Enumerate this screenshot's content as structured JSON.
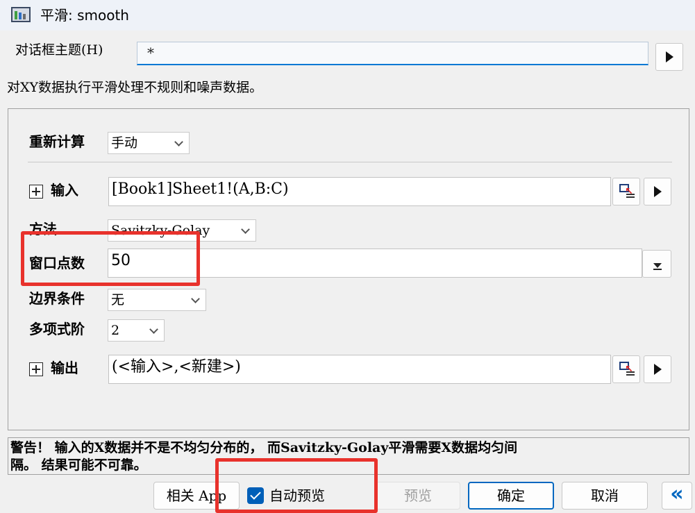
{
  "window": {
    "title": "平滑: smooth",
    "icon": "origin-app-icon"
  },
  "theme": {
    "label": "对话框主题(H)",
    "value": "*"
  },
  "description": "对XY数据执行平滑处理不规则和噪声数据。",
  "form": {
    "recalc_label": "重新计算",
    "recalc_value": "手动",
    "input_label": "输入",
    "input_value": "[Book1]Sheet1!(A,B:C)",
    "method_label": "方法",
    "method_value": "Savitzky-Golay",
    "window_points_label": "窗口点数",
    "window_points_value": "50",
    "boundary_label": "边界条件",
    "boundary_value": "无",
    "poly_order_label": "多项式阶",
    "poly_order_value": "2",
    "output_label": "输出",
    "output_value": "(<输入>,<新建>)"
  },
  "warning": {
    "line1": "警告！ 输入的X数据并不是不均匀分布的， 而Savitzky-Golay平滑需要X数据均匀间",
    "line2": "隔。 结果可能不可靠。"
  },
  "buttons": {
    "related_app": "相关 App",
    "auto_preview": "自动预览",
    "auto_preview_checked": true,
    "preview": "预览",
    "ok": "确定",
    "cancel": "取消",
    "collapse": "«"
  },
  "colors": {
    "accent": "#0067c0",
    "highlight": "#e8322c",
    "checkbox": "#005fb8"
  }
}
